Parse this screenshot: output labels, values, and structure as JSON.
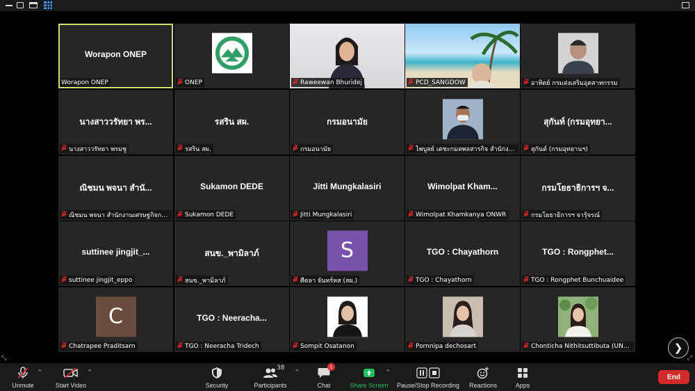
{
  "tiles": [
    {
      "title": "Worapon ONEP",
      "tag": "Worapon ONEP",
      "muted": false,
      "media": "none",
      "active": true
    },
    {
      "title": "",
      "tag": "ONEP",
      "muted": true,
      "media": "logo"
    },
    {
      "title": "",
      "tag": "Raweewan Bhuridej",
      "muted": true,
      "media": "video-office"
    },
    {
      "title": "",
      "tag": "PCD_SANGDOW",
      "muted": true,
      "media": "video-beach"
    },
    {
      "title": "",
      "tag": "อาทิตย์ กรมส่งเสริมอุตสาหกรรม",
      "muted": true,
      "media": "photo-man"
    },
    {
      "title": "นางสาววรัทยา พร...",
      "tag": "นางสาววรัทยา พรมชู",
      "muted": true,
      "media": "none"
    },
    {
      "title": "รสริน สผ.",
      "tag": "รสริน สผ.",
      "muted": true,
      "media": "none"
    },
    {
      "title": "กรมอนามัย",
      "tag": "กรมอนามัย",
      "muted": true,
      "media": "none"
    },
    {
      "title": "",
      "tag": "ไพบูลย์ เตชะกมลพลสารกิจ สำนักงานเศ...",
      "muted": true,
      "media": "photo-mask"
    },
    {
      "title": "สุกันท์ (กรมอุทยา...",
      "tag": "สุกันต์ (กรมอุทยานฯ)",
      "muted": true,
      "media": "none"
    },
    {
      "title": "ณิชมน พจนา สำนั...",
      "tag": "ณิชมน พจนา สำนักงานเศรษฐกิจการเ...",
      "muted": true,
      "media": "none"
    },
    {
      "title": "Sukamon DEDE",
      "tag": "Sukamon DEDE",
      "muted": true,
      "media": "none"
    },
    {
      "title": "Jitti Mungkalasiri",
      "tag": "Jitti Mungkalasiri",
      "muted": true,
      "media": "none"
    },
    {
      "title": "Wimolpat  Kham...",
      "tag": "Wimolpat Khamkanya ONWR",
      "muted": true,
      "media": "none"
    },
    {
      "title": "กรมโยธาธิการฯ จ...",
      "tag": "กรมโยธาธิการฯ จารุ้จรณ์",
      "muted": true,
      "media": "none"
    },
    {
      "title": "suttinee  jingjit_...",
      "tag": "suttinee jingjit_eppo",
      "muted": true,
      "media": "none"
    },
    {
      "title": "สนข._พามิลาภ์",
      "tag": "สนข._พามิลาภ์",
      "muted": true,
      "media": "none"
    },
    {
      "title": "",
      "tag": "ศีตลา จันทร์หส (สผ.)",
      "muted": true,
      "media": "letter",
      "letter": "S",
      "letter_color": "#7b52ab"
    },
    {
      "title": "TGO : Chayathorn",
      "tag": "TGO : Chayathorn",
      "muted": true,
      "media": "none"
    },
    {
      "title": "TGO :  Rongphet...",
      "tag": "TGO : Rongphet Bunchuaidee",
      "muted": true,
      "media": "none"
    },
    {
      "title": "",
      "tag": "Chatrapee Praditsarn",
      "muted": true,
      "media": "letter",
      "letter": "C",
      "letter_color": "#6b4b3e"
    },
    {
      "title": "TGO :  Neeracha...",
      "tag": "TGO : Neeracha Tridech",
      "muted": true,
      "media": "none"
    },
    {
      "title": "",
      "tag": "Sompit Osatanon",
      "muted": true,
      "media": "photo-woman-white"
    },
    {
      "title": "",
      "tag": "Pornnipa dechosart",
      "muted": true,
      "media": "photo-woman-shop"
    },
    {
      "title": "",
      "tag": "Chonticha Nithitsuttibuta (UNDP)",
      "muted": true,
      "media": "photo-woman-garden"
    }
  ],
  "toolbar": {
    "unmute": "Unmute",
    "start_video": "Start Video",
    "security": "Security",
    "participants": "Participants",
    "participants_count": "38",
    "chat": "Chat",
    "chat_badge": "1",
    "share_screen": "Share Screen",
    "recording": "Pause/Stop Recording",
    "reactions": "Reactions",
    "apps": "Apps",
    "end": "End"
  },
  "colors": {
    "active_speaker": "#c9e06a",
    "share": "#20c05c",
    "end": "#d32a2a",
    "muted": "#e02828"
  }
}
